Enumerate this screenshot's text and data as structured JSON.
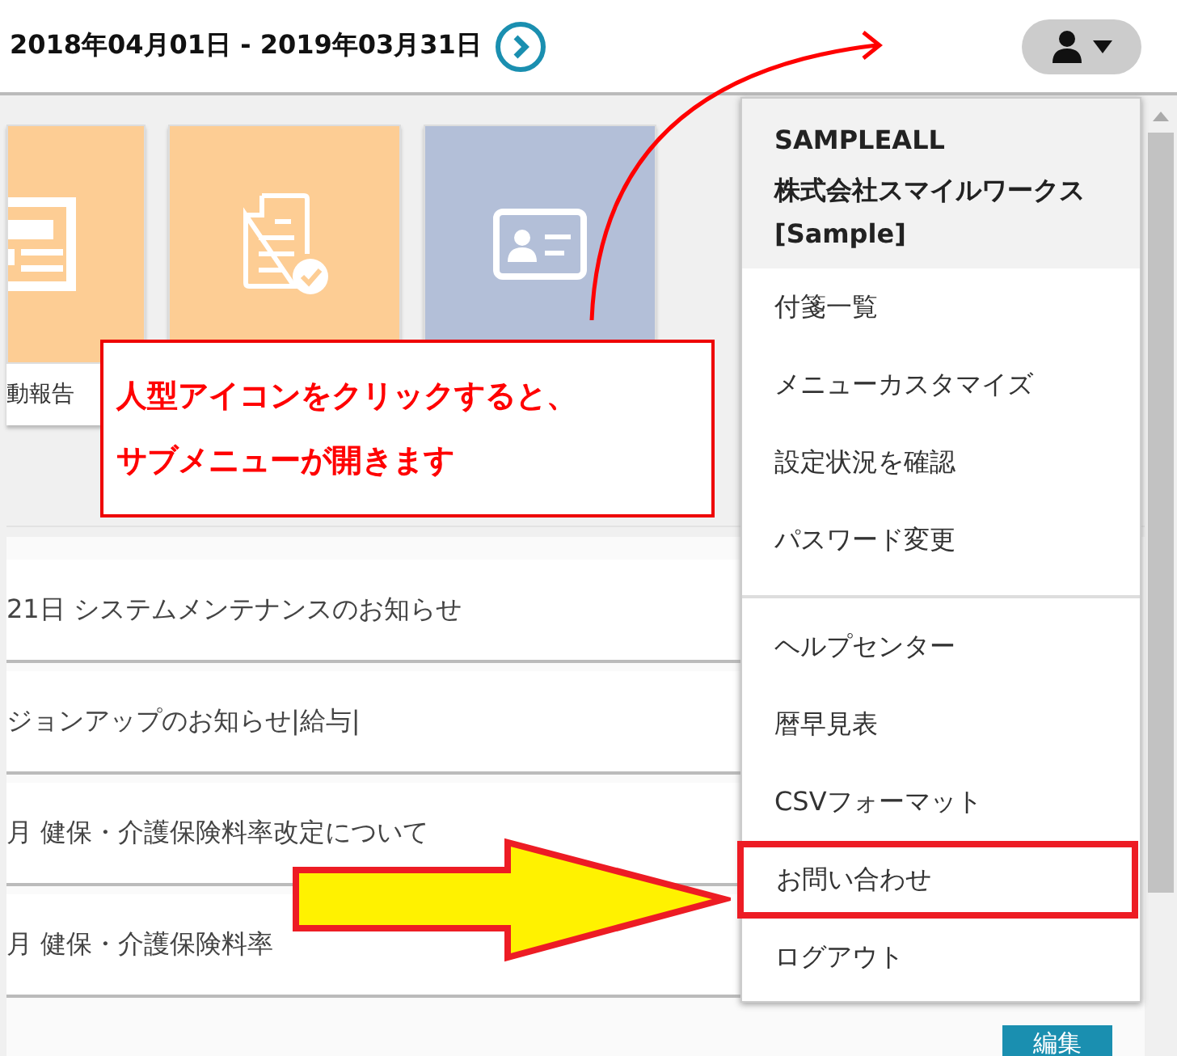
{
  "header": {
    "period": "2018年04月01日 - 2019年03月31日"
  },
  "tiles": [
    {
      "kind": "form",
      "color": "#fdcd94",
      "label": "動報告"
    },
    {
      "kind": "document",
      "color": "#fdcd94"
    },
    {
      "kind": "idcard",
      "color": "#b3bfd8"
    }
  ],
  "notices": [
    "21日 システムメンテナンスのお知らせ",
    "ジョンアップのお知らせ|給与|",
    "月 健保・介護保険料率改定について",
    "月 健保・介護保険料率"
  ],
  "edit_button": "編集",
  "user_menu": {
    "expanded": true,
    "account": "SAMPLEALL",
    "company": "株式会社スマイルワークス[Sample]",
    "groups": [
      [
        {
          "label": "付箋一覧",
          "highlighted": false
        },
        {
          "label": "メニューカスタマイズ",
          "highlighted": false
        },
        {
          "label": "設定状況を確認",
          "highlighted": false
        },
        {
          "label": "パスワード変更",
          "highlighted": false
        }
      ],
      [
        {
          "label": "ヘルプセンター",
          "highlighted": false
        },
        {
          "label": "暦早見表",
          "highlighted": false
        },
        {
          "label": "CSVフォーマット",
          "highlighted": false
        },
        {
          "label": "お問い合わせ",
          "highlighted": true
        },
        {
          "label": "ログアウト",
          "highlighted": false
        }
      ]
    ]
  },
  "annotation": {
    "callout": [
      "人型アイコンをクリックすると、",
      "サブメニューが開きます"
    ]
  }
}
